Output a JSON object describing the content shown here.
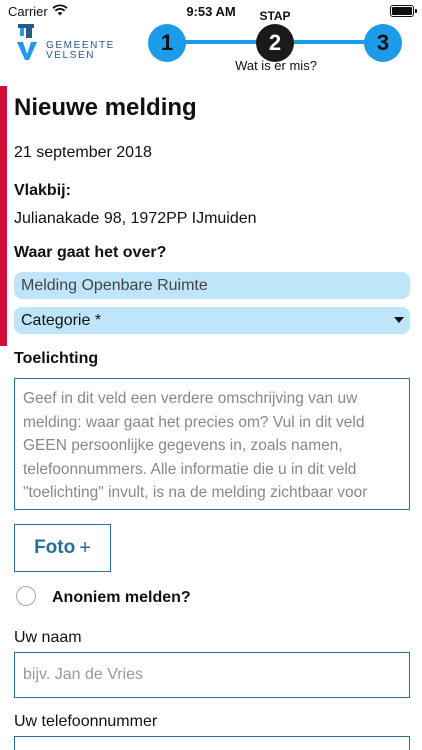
{
  "status_bar": {
    "carrier": "Carrier",
    "time": "9:53 AM"
  },
  "brand": {
    "name": "GEMEENTE VELSEN",
    "line1": "GEMEENTE",
    "line2": "VELSEN",
    "color": "#2a5a8a"
  },
  "stepper": {
    "label": "STAP",
    "steps": [
      "1",
      "2",
      "3"
    ],
    "active_step": 2,
    "caption": "Wat is er mis?",
    "accent_color": "#1e9be8"
  },
  "form": {
    "title": "Nieuwe melding",
    "date": "21 september 2018",
    "near_label": "Vlakbij:",
    "near_value": "Julianakade 98, 1972PP IJmuiden",
    "about_label": "Waar gaat het over?",
    "about_value": "Melding Openbare Ruimte",
    "category_value": "Categorie *",
    "description_label": "Toelichting",
    "description_placeholder": "Geef in dit veld een verdere omschrijving van uw melding: waar gaat het precies om? Vul in dit veld GEEN persoonlijke gegevens in, zoals namen, telefoonnummers. Alle informatie die u in dit veld \"toelichting\" invult, is na de melding zichtbaar voor",
    "photo_button": "Foto",
    "photo_plus": "+",
    "anonymous_label": "Anoniem melden?",
    "name_label": "Uw naam",
    "name_placeholder": "bijv. Jan de Vries",
    "phone_label": "Uw telefoonnummer"
  },
  "colors": {
    "accent_bar": "#d0103a",
    "field_fill": "#bfe5fb",
    "field_border": "#2a6d9a"
  }
}
